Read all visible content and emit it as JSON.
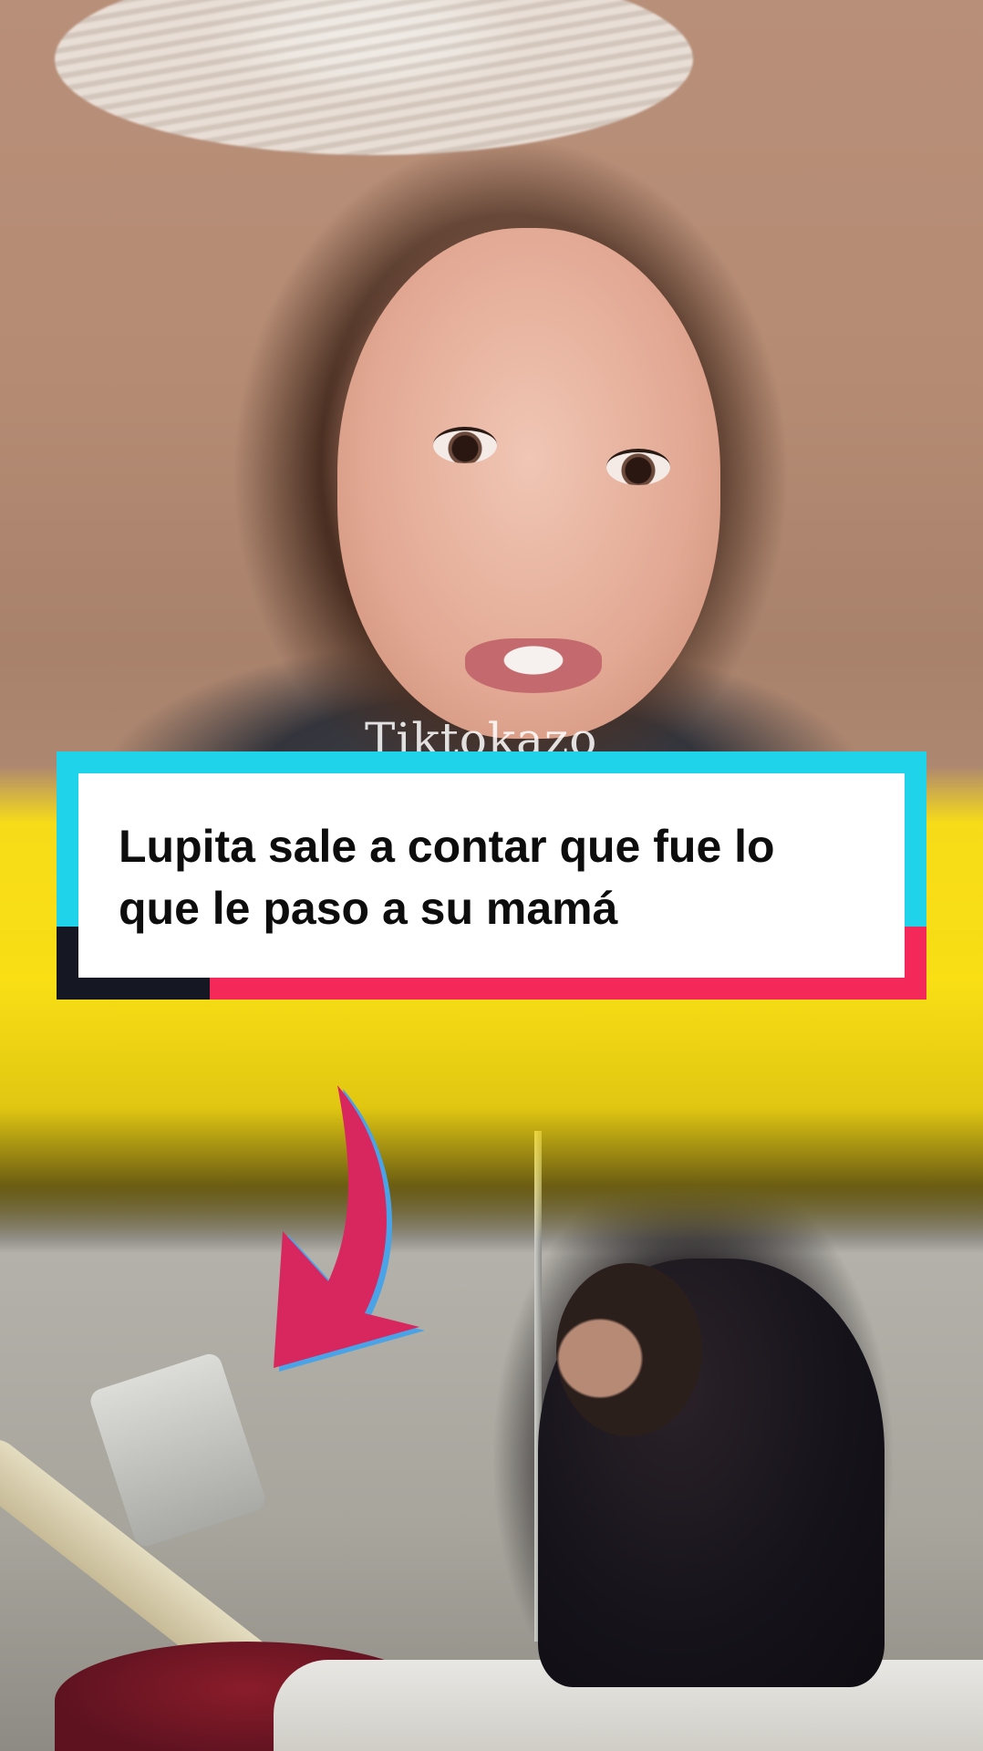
{
  "watermark": {
    "text": "Tiktokazo"
  },
  "caption": {
    "line1": "Lupita sale a contar que fue lo",
    "line2": "que le paso a su mamá"
  },
  "colors": {
    "caption_frame_cyan": "#1fd3ea",
    "caption_bar_dark": "#151722",
    "caption_bar_red": "#f5285a",
    "caption_background": "#ffffff",
    "band_yellow": "#f9df14",
    "arrow_pink": "#d8275e",
    "arrow_outline_blue": "#4aa3e6"
  },
  "icons": {
    "pointer": "down-left-arrow"
  }
}
